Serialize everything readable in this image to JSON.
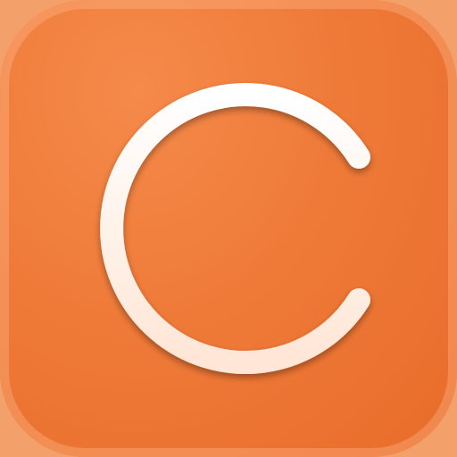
{
  "app_icon": {
    "glyph_icon": "c-plus-icon",
    "colors": {
      "background": "#ef7a38",
      "background_dark": "#e86c2a",
      "glyph": "#fff4ec",
      "glyph_shadow": "#c85a1e"
    }
  }
}
